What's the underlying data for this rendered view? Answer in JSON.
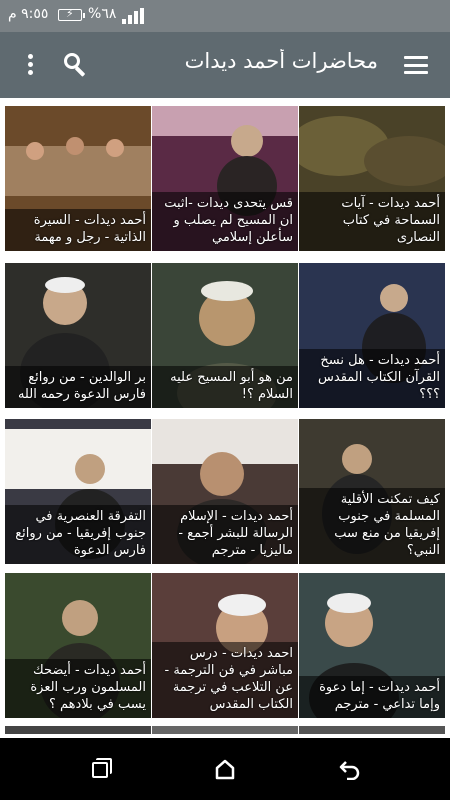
{
  "status_bar": {
    "time": "٩:٥٥ م",
    "battery_percent": "%٦٨",
    "battery_level": 0.68,
    "signal_bars": 4
  },
  "app_bar": {
    "title": "محاضرات أحمد ديدات",
    "menu_icon": "hamburger-menu-icon",
    "search_icon": "search-icon",
    "more_icon": "more-vert-icon"
  },
  "videos": [
    {
      "caption": "أحمد ديدات - آيات السماحة في كتاب النصارى",
      "bg": "#4a4228"
    },
    {
      "caption": "قس يتحدى ديدات -اثبت ان المسيح لم يصلب و سأعلن إسلامي",
      "bg": "#5a2a45"
    },
    {
      "caption": "أحمد ديدات - السيرة الذاتية - رجل و مهمة",
      "bg": "#6b4a2a"
    },
    {
      "caption": "أحمد ديدات - هل نسخ القرآن الكتاب المقدس ؟؟؟",
      "bg": "#2a3450"
    },
    {
      "caption": "من هو أبو المسيح عليه السلام ؟!",
      "bg": "#3a4538"
    },
    {
      "caption": "بر الوالدين - من روائع فارس الدعوة رحمه الله",
      "bg": "#2e2e2a"
    },
    {
      "caption": "كيف تمكنت الأقلية المسلمة في جنوب إفريقيا من منع سب النبي؟",
      "bg": "#3e3a30"
    },
    {
      "caption": "أحمد ديدات - الإسلام الرسالة للبشر أجمع - ماليزيا - مترجم",
      "bg": "#4a3a36"
    },
    {
      "caption": "التفرقة العنصرية في جنوب إفريقيا - من روائع فارس الدعوة",
      "bg": "#3a3a44"
    },
    {
      "caption": "أحمد ديدات - إما دعوة وإما تداعي - مترجم",
      "bg": "#3a4a4a"
    },
    {
      "caption": "احمد ديدات - درس مباشر في فن الترجمة - عن التلاعب في ترجمة الكتاب المقدس",
      "bg": "#5a3e3a"
    },
    {
      "caption": "أحمد ديدات - أيضحك المسلمون ورب العزة يسب في بلادهم ؟",
      "bg": "#3a4a2e"
    }
  ],
  "nav_bar": {
    "recents_icon": "recents-icon",
    "home_icon": "home-icon",
    "back_icon": "back-icon"
  }
}
